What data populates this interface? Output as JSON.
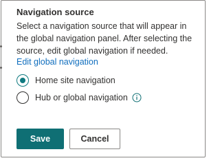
{
  "panel": {
    "title": "Navigation source",
    "description": "Select a navigation source that will appear in the global navigation panel. After selecting the source, edit global navigation if needed.",
    "edit_link": "Edit global navigation"
  },
  "options": [
    {
      "label": "Home site navigation",
      "selected": true
    },
    {
      "label": "Hub or global navigation",
      "selected": false,
      "icon": "info-icon"
    }
  ],
  "buttons": {
    "save_label": "Save",
    "cancel_label": "Cancel"
  },
  "colors": {
    "accent": "#0f6f74",
    "link": "#106ebe",
    "text": "#323130",
    "border": "#8a8886"
  }
}
